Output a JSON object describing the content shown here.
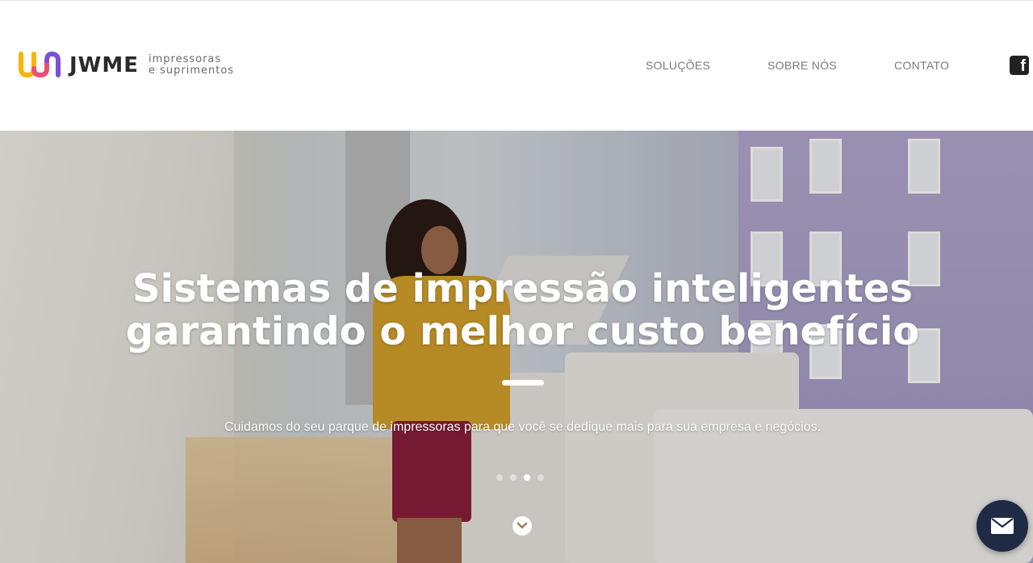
{
  "logo": {
    "wordmark": "JWME",
    "tagline_line1": "impressoras",
    "tagline_line2": "e suprimentos",
    "colors": [
      "#f7b500",
      "#e94e77",
      "#7b4fd6"
    ]
  },
  "nav": {
    "items": [
      "SOLUÇÕES",
      "SOBRE NÓS",
      "CONTATO"
    ]
  },
  "social": {
    "facebook_icon": "facebook-icon",
    "facebook_glyph": "f"
  },
  "hero": {
    "title": "Sistemas de impressão inteligentes garantindo o melhor custo benefício",
    "subtitle": "Cuidamos do seu parque de impressoras para que você se dedique mais para sua empresa e negócios.",
    "slides_total": 4,
    "active_slide": 3
  },
  "floating": {
    "mail_icon": "envelope-icon",
    "mail_color": "#1f2a44"
  }
}
